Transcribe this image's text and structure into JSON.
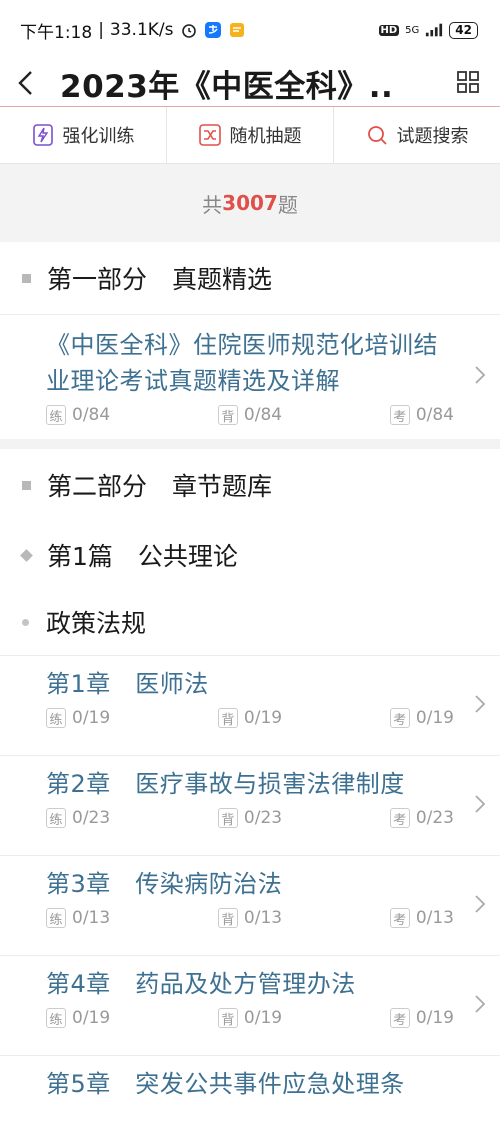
{
  "status": {
    "time": "下午1:18",
    "speed": "33.1K/s",
    "hd": "HD",
    "signal": "5G",
    "battery": "42"
  },
  "nav": {
    "title": "2023年《中医全科》...",
    "back_icon": "back-arrow-icon",
    "menu_icon": "grid-icon"
  },
  "toolbar": {
    "train": "强化训练",
    "random": "随机抽题",
    "search": "试题搜索"
  },
  "count": {
    "prefix": "共",
    "number": "3007",
    "suffix": "题"
  },
  "part1": {
    "title": "第一部分　真题精选",
    "item": {
      "title": "《中医全科》住院医师规范化培训结业理论考试真题精选及详解",
      "practice_tag": "练",
      "practice": "0/84",
      "recite_tag": "背",
      "recite": "0/84",
      "exam_tag": "考",
      "exam": "0/84"
    }
  },
  "part2": {
    "title": "第二部分　章节题库",
    "volume": "第1篇　公共理论",
    "section": "政策法规",
    "chapters": [
      {
        "title": "第1章　医师法",
        "p": "0/19",
        "r": "0/19",
        "e": "0/19"
      },
      {
        "title": "第2章　医疗事故与损害法律制度",
        "p": "0/23",
        "r": "0/23",
        "e": "0/23"
      },
      {
        "title": "第3章　传染病防治法",
        "p": "0/13",
        "r": "0/13",
        "e": "0/13"
      },
      {
        "title": "第4章　药品及处方管理办法",
        "p": "0/19",
        "r": "0/19",
        "e": "0/19"
      },
      {
        "title": "第5章　突发公共事件应急处理条"
      }
    ],
    "tags": {
      "p": "练",
      "r": "背",
      "e": "考"
    }
  }
}
